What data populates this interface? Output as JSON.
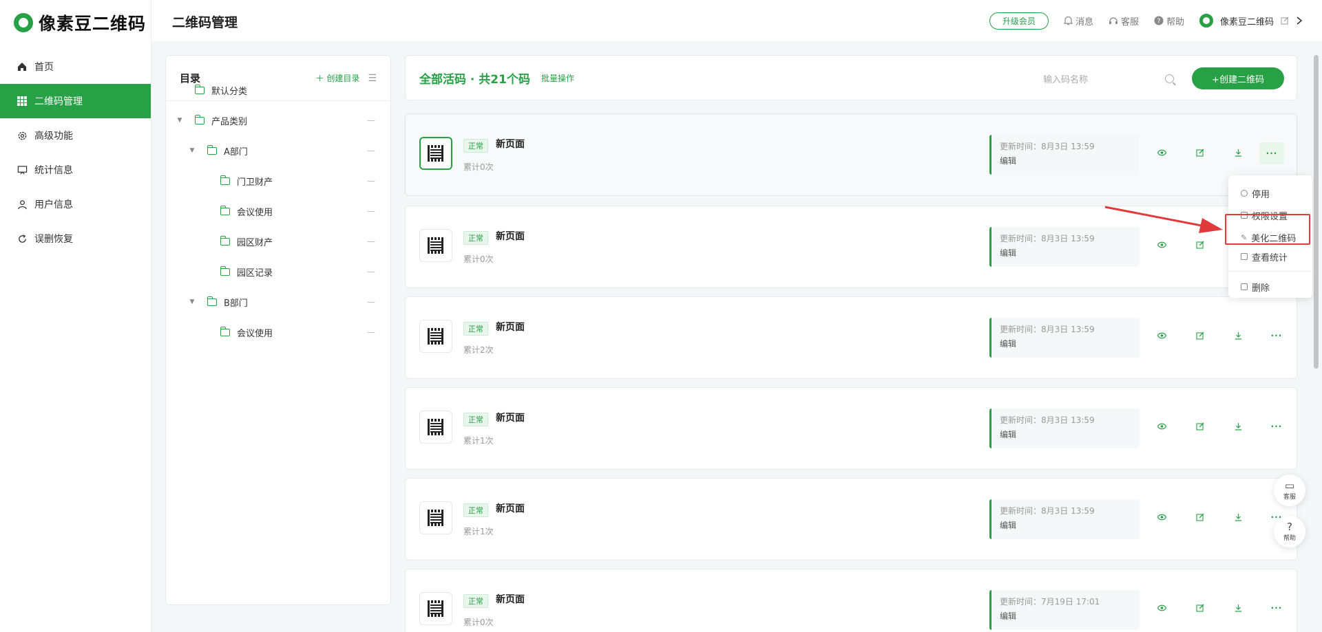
{
  "app": {
    "logo_text": "像素豆二维码",
    "page_title": "二维码管理"
  },
  "sidebar": {
    "items": [
      {
        "label": "首页",
        "icon": "home-icon"
      },
      {
        "label": "二维码管理",
        "icon": "grid-icon"
      },
      {
        "label": "高级功能",
        "icon": "gear-icon"
      },
      {
        "label": "统计信息",
        "icon": "chart-board-icon"
      },
      {
        "label": "用户信息",
        "icon": "user-icon"
      },
      {
        "label": "误删恢复",
        "icon": "restore-icon"
      }
    ],
    "active_index": 1
  },
  "topbar": {
    "upgrade": "升级会员",
    "messages": "消息",
    "service": "客服",
    "help": "帮助",
    "username": "像素豆二维码"
  },
  "directory": {
    "title": "目录",
    "create": "创建目录",
    "tree": [
      {
        "label": "默认分类"
      },
      {
        "label": "产品类别"
      },
      {
        "label": "A部门"
      },
      {
        "label": "门卫财产"
      },
      {
        "label": "会议使用"
      },
      {
        "label": "园区财产"
      },
      {
        "label": "园区记录"
      },
      {
        "label": "B部门"
      },
      {
        "label": "会议使用"
      }
    ]
  },
  "list": {
    "title": "全部活码 · 共21个码",
    "batch": "批量操作",
    "search_placeholder": "输入码名称",
    "create_button": "+创建二维码",
    "status_label": "正常",
    "edit_label": "编辑",
    "cards": [
      {
        "name": "新页面",
        "count": "累计0次",
        "updated": "更新时间：8月3日 13:59"
      },
      {
        "name": "新页面",
        "count": "累计0次",
        "updated": "更新时间：8月3日 13:59"
      },
      {
        "name": "新页面",
        "count": "累计2次",
        "updated": "更新时间：8月3日 13:59"
      },
      {
        "name": "新页面",
        "count": "累计1次",
        "updated": "更新时间：8月3日 13:59"
      },
      {
        "name": "新页面",
        "count": "累计1次",
        "updated": "更新时间：8月3日 13:59"
      },
      {
        "name": "新页面",
        "count": "累计0次",
        "updated": "更新时间：7月19日 17:01"
      }
    ]
  },
  "dropdown": {
    "items": [
      {
        "label": "停用",
        "icon": "pause-icon"
      },
      {
        "label": "权限设置",
        "icon": "lock-icon"
      },
      {
        "label": "美化二维码",
        "icon": "brush-icon"
      },
      {
        "label": "查看统计",
        "icon": "stats-icon"
      },
      {
        "label": "删除",
        "icon": "trash-icon"
      }
    ]
  },
  "floating": {
    "service": "客服",
    "help": "帮助"
  },
  "colors": {
    "brand": "#27a046",
    "annotation": "#e03a3a"
  }
}
